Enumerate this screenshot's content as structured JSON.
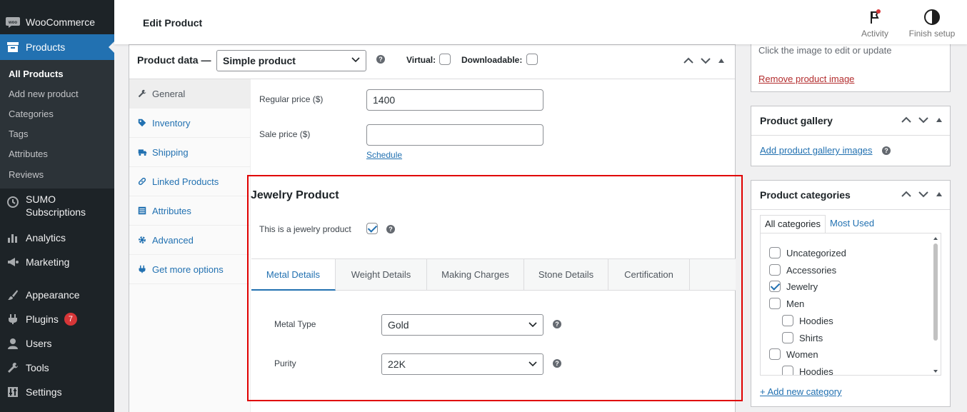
{
  "sidebar": {
    "brand": "WooCommerce",
    "products": "Products",
    "submenu": [
      "All Products",
      "Add new product",
      "Categories",
      "Tags",
      "Attributes",
      "Reviews"
    ],
    "sumo": [
      "SUMO",
      "Subscriptions"
    ],
    "analytics": "Analytics",
    "marketing": "Marketing",
    "appearance": "Appearance",
    "plugins": "Plugins",
    "plugins_badge": "7",
    "users": "Users",
    "tools": "Tools",
    "settings": "Settings"
  },
  "header": {
    "title": "Edit Product",
    "activity": "Activity",
    "finish_setup": "Finish setup"
  },
  "product_data": {
    "title": "Product data —",
    "type": "Simple product",
    "virtual": "Virtual:",
    "downloadable": "Downloadable:",
    "tabs": [
      "General",
      "Inventory",
      "Shipping",
      "Linked Products",
      "Attributes",
      "Advanced",
      "Get more options"
    ],
    "regular_price_label": "Regular price ($)",
    "regular_price": "1400",
    "sale_price_label": "Sale price ($)",
    "sale_price": "",
    "schedule": "Schedule"
  },
  "jewelry": {
    "title": "Jewelry Product",
    "checkbox_label": "This is a jewelry product",
    "tabs": [
      "Metal Details",
      "Weight Details",
      "Making Charges",
      "Stone Details",
      "Certification"
    ],
    "metal_type_label": "Metal Type",
    "metal_type": "Gold",
    "purity_label": "Purity",
    "purity": "22K"
  },
  "image_box": {
    "hint": "Click the image to edit or update",
    "remove": "Remove product image"
  },
  "gallery": {
    "title": "Product gallery",
    "add": "Add product gallery images"
  },
  "categories": {
    "title": "Product categories",
    "tab_all": "All categories",
    "tab_most": "Most Used",
    "items": [
      "Uncategorized",
      "Accessories",
      "Jewelry",
      "Men",
      "Hoodies",
      "Shirts",
      "Women",
      "Hoodies"
    ],
    "add": "+ Add new category"
  },
  "colors": {
    "accent": "#2271b1",
    "sidebar_bg": "#1d2327",
    "highlight": "#e00000",
    "badge": "#d63638"
  }
}
